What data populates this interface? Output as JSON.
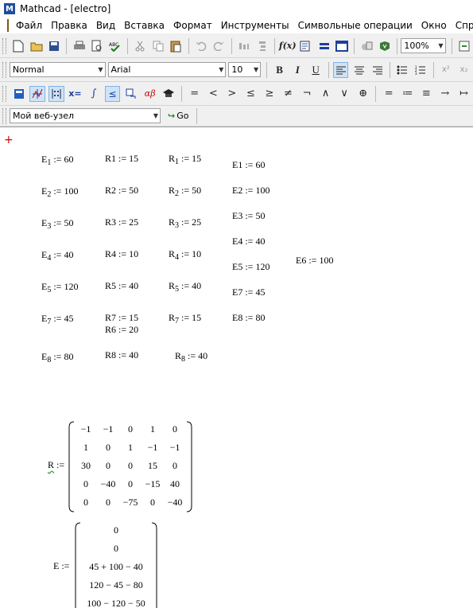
{
  "window": {
    "title": "Mathcad - [electro]"
  },
  "menu": [
    "Файл",
    "Правка",
    "Вид",
    "Вставка",
    "Формат",
    "Инструменты",
    "Символьные операции",
    "Окно",
    "Справка"
  ],
  "toolbar_standard": {
    "zoom": "100%"
  },
  "toolbar_format": {
    "style": "Normal",
    "font": "Arial",
    "size": "10"
  },
  "toolbar_web": {
    "address": "Мой веб-узел",
    "go_label": "Go"
  },
  "worksheet": {
    "col1": [
      {
        "base": "E",
        "sub": "1",
        "value": "60"
      },
      {
        "base": "E",
        "sub": "2",
        "value": "100"
      },
      {
        "base": "E",
        "sub": "3",
        "value": "50"
      },
      {
        "base": "E",
        "sub": "4",
        "value": "40"
      },
      {
        "base": "E",
        "sub": "5",
        "value": "120"
      },
      {
        "base": "E",
        "sub": "7",
        "value": "45"
      },
      {
        "base": "E",
        "sub": "8",
        "value": "80"
      }
    ],
    "col2": [
      {
        "name": "R1",
        "value": "15"
      },
      {
        "name": "R2",
        "value": "50"
      },
      {
        "name": "R3",
        "value": "25"
      },
      {
        "name": "R4",
        "value": "10"
      },
      {
        "name": "R5",
        "value": "40"
      },
      {
        "name": "R7",
        "value": "15"
      },
      {
        "name": "R6",
        "value": "20"
      },
      {
        "name": "R8",
        "value": "40"
      }
    ],
    "col3": [
      {
        "base": "R",
        "sub": "1",
        "value": "15"
      },
      {
        "base": "R",
        "sub": "2",
        "value": "50"
      },
      {
        "base": "R",
        "sub": "3",
        "value": "25"
      },
      {
        "base": "R",
        "sub": "4",
        "value": "10"
      },
      {
        "base": "R",
        "sub": "5",
        "value": "40"
      },
      {
        "base": "R",
        "sub": "7",
        "value": "15"
      },
      {
        "base": "R",
        "sub": "8",
        "value": "40"
      }
    ],
    "col4": [
      {
        "name": "E1",
        "value": "60"
      },
      {
        "name": "E2",
        "value": "100"
      },
      {
        "name": "E3",
        "value": "50"
      },
      {
        "name": "E4",
        "value": "40"
      },
      {
        "name": "E5",
        "value": "120"
      },
      {
        "name": "E7",
        "value": "45"
      },
      {
        "name": "E8",
        "value": "80"
      }
    ],
    "e6": {
      "name": "E6",
      "value": "100"
    },
    "matrix_R": {
      "name": "R",
      "rows": [
        [
          "−1",
          "−1",
          "0",
          "1",
          "0"
        ],
        [
          "1",
          "0",
          "1",
          "−1",
          "−1"
        ],
        [
          "30",
          "0",
          "0",
          "15",
          "0"
        ],
        [
          "0",
          "−40",
          "0",
          "−15",
          "40"
        ],
        [
          "0",
          "0",
          "−75",
          "0",
          "−40"
        ]
      ]
    },
    "matrix_E": {
      "name": "E",
      "rows": [
        "0",
        "0",
        "45 + 100 − 40",
        "120 − 45 − 80",
        "100 − 120 − 50"
      ]
    },
    "define_symbol": ":=",
    "red_cursor": "+"
  }
}
